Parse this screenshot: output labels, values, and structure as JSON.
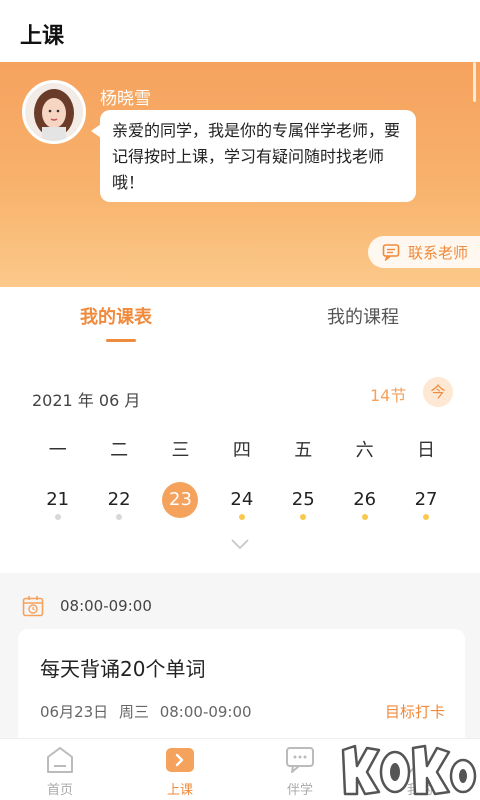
{
  "header": {
    "title": "上课"
  },
  "teacher": {
    "name": "杨晓雪",
    "message": "亲爱的同学，我是你的专属伴学老师，要记得按时上课，学习有疑问随时找老师哦！",
    "contact_label": "联系老师"
  },
  "tabs": {
    "active": "我的课表",
    "inactive": "我的课程"
  },
  "calendar": {
    "month_label": "2021 年 06 月",
    "lesson_count": "14节",
    "today_label": "今",
    "weekdays": [
      "一",
      "二",
      "三",
      "四",
      "五",
      "六",
      "日"
    ],
    "days": [
      {
        "num": "21",
        "dot": "grey"
      },
      {
        "num": "22",
        "dot": "grey"
      },
      {
        "num": "23",
        "dot": "none",
        "selected": true
      },
      {
        "num": "24",
        "dot": "yellow"
      },
      {
        "num": "25",
        "dot": "yellow"
      },
      {
        "num": "26",
        "dot": "yellow"
      },
      {
        "num": "27",
        "dot": "yellow"
      }
    ]
  },
  "schedule": {
    "time_header": "08:00-09:00",
    "card": {
      "title": "每天背诵20个单词",
      "meta": "06月23日 周三 08:00-09:00",
      "action": "目标打卡"
    }
  },
  "tabbar": [
    {
      "label": "首页",
      "icon": "home-icon",
      "active": false
    },
    {
      "label": "上课",
      "icon": "class-play-icon",
      "active": true
    },
    {
      "label": "伴学",
      "icon": "chat-icon",
      "active": false
    },
    {
      "label": "我的",
      "icon": "profile-icon",
      "active": false
    }
  ],
  "colors": {
    "accent": "#f08a3c",
    "banner_top": "#f5a25e",
    "banner_bottom": "#fbc98a",
    "dot_yellow": "#f8c94c"
  },
  "watermark": {
    "text": "KOKO"
  }
}
